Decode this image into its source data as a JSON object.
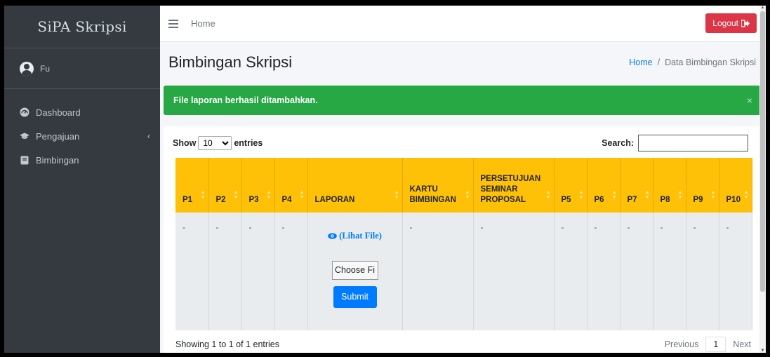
{
  "brand": "SiPA Skripsi",
  "user": {
    "name": "Fu"
  },
  "sidebar": {
    "items": [
      {
        "label": "Dashboard",
        "icon": "tachometer-icon"
      },
      {
        "label": "Pengajuan",
        "icon": "graduation-cap-icon"
      },
      {
        "label": "Bimbingan",
        "icon": "book-icon"
      }
    ]
  },
  "topbar": {
    "home": "Home",
    "logout": "Logout"
  },
  "header": {
    "title": "Bimbingan Skripsi",
    "breadcrumb": {
      "home": "Home",
      "separator": "/",
      "current": "Data Bimbingan Skripsi"
    }
  },
  "alert": {
    "message": "File laporan berhasil ditambahkan.",
    "close": "×"
  },
  "datatable": {
    "show_label": "Show",
    "entries_label": "entries",
    "page_length": "10",
    "search_label": "Search:",
    "search_value": "",
    "columns": [
      "P1",
      "P2",
      "P3",
      "P4",
      "LAPORAN",
      "KARTU BIMBINGAN",
      "PERSETUJUAN SEMINAR PROPOSAL",
      "P5",
      "P6",
      "P7",
      "P8",
      "P9",
      "P10"
    ],
    "row": {
      "p1": "-",
      "p2": "-",
      "p3": "-",
      "p4": "-",
      "laporan_link": "(Lihat File)",
      "choose_file": "Choose Fi",
      "submit": "Submit",
      "kartu": "-",
      "persetujuan": "-",
      "p5": "-",
      "p6": "-",
      "p7": "-",
      "p8": "-",
      "p9": "-",
      "p10": "-"
    },
    "info": "Showing 1 to 1 of 1 entries",
    "pagination": {
      "previous": "Previous",
      "page": "1",
      "next": "Next"
    }
  },
  "colors": {
    "sidebar": "#343a40",
    "alert": "#28a745",
    "header_row": "#ffc107",
    "logout": "#dc3545",
    "primary": "#007bff"
  }
}
